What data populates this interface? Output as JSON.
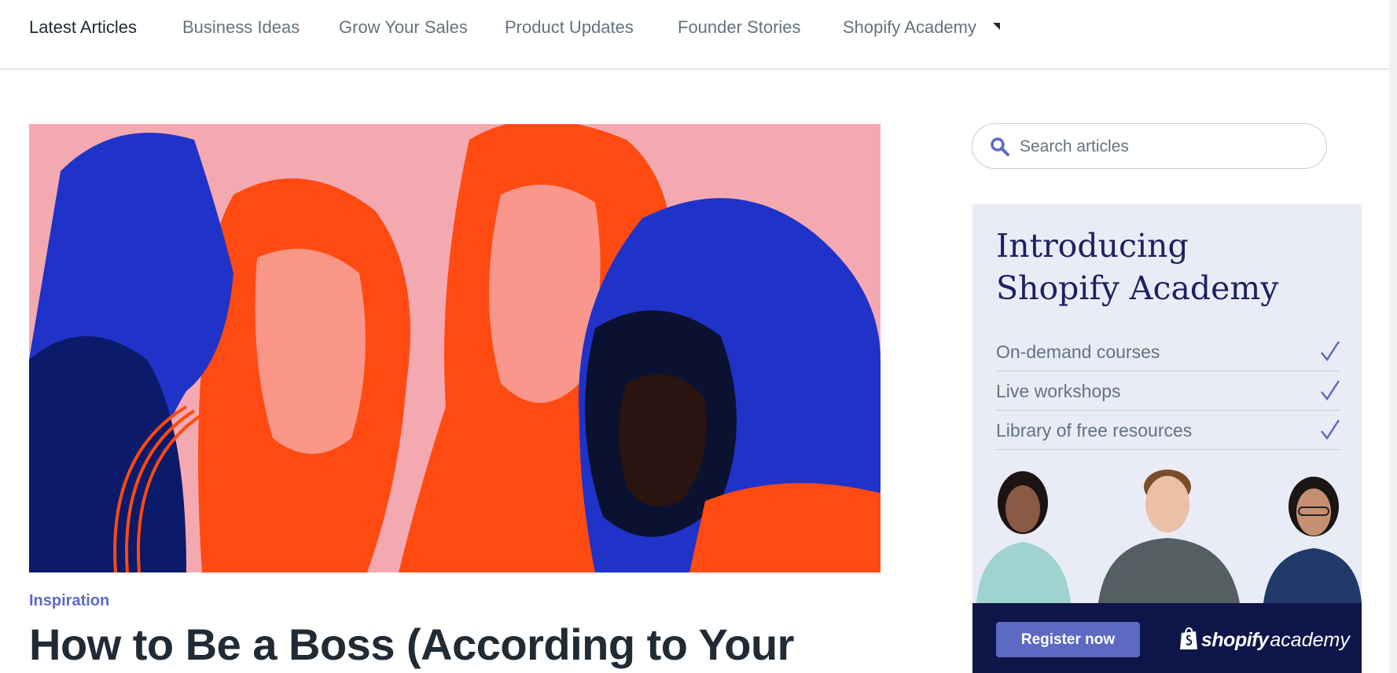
{
  "nav": {
    "items": [
      {
        "label": "Latest Articles"
      },
      {
        "label": "Business Ideas"
      },
      {
        "label": "Grow Your Sales"
      },
      {
        "label": "Product Updates"
      },
      {
        "label": "Founder Stories"
      },
      {
        "label": "Shopify Academy"
      }
    ],
    "dropdown_icon": "caret-icon"
  },
  "article": {
    "category": "Inspiration",
    "title": "How to Be a Boss (According to Your"
  },
  "search": {
    "placeholder": "Search articles",
    "value": "",
    "icon": "search-icon"
  },
  "ad": {
    "title_line1": "Introducing",
    "title_line2": "Shopify Academy",
    "features": [
      {
        "label": "On-demand courses"
      },
      {
        "label": "Live workshops"
      },
      {
        "label": "Library of free resources"
      }
    ],
    "register_label": "Register now",
    "brand_word": "shopify",
    "brand_sub": "academy"
  },
  "colors": {
    "accent": "#5c6ac4",
    "ad_navy": "#1c2260",
    "ad_footer": "#0e1548",
    "hero_pink": "#f3a6ae",
    "hero_orange": "#ff4a12",
    "hero_blue": "#1f33c9"
  }
}
